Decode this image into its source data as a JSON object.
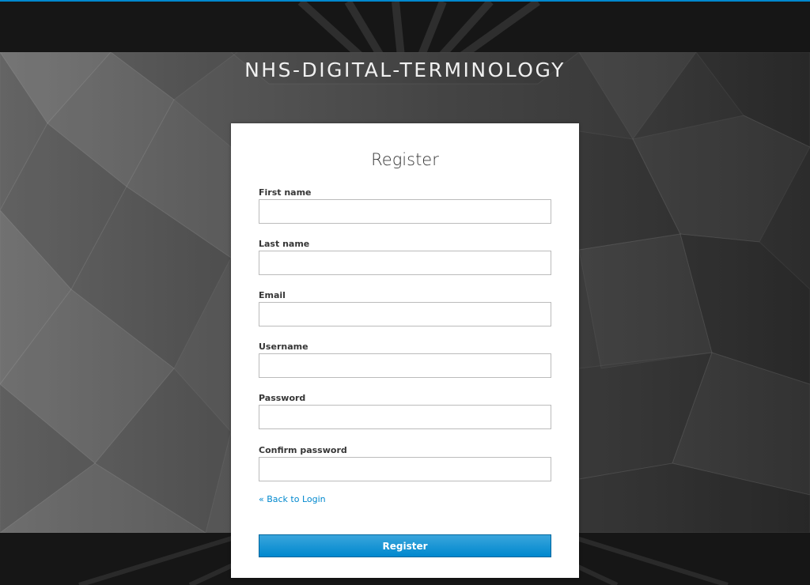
{
  "realm": {
    "title": "NHS-DIGITAL-TERMINOLOGY"
  },
  "form": {
    "heading": "Register",
    "fields": [
      {
        "label": "First name",
        "value": ""
      },
      {
        "label": "Last name",
        "value": ""
      },
      {
        "label": "Email",
        "value": ""
      },
      {
        "label": "Username",
        "value": ""
      },
      {
        "label": "Password",
        "value": ""
      },
      {
        "label": "Confirm password",
        "value": ""
      }
    ],
    "back_link": "« Back to Login",
    "submit_label": "Register"
  },
  "colors": {
    "accent": "#0088ce",
    "button": "#0088ce",
    "card": "#ffffff",
    "background": "#181818"
  }
}
